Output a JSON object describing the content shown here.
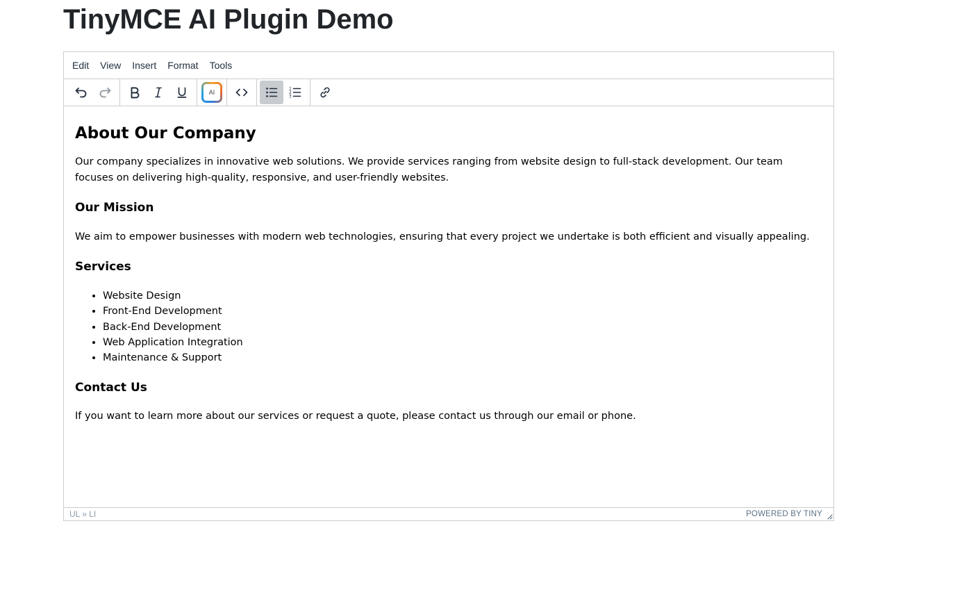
{
  "page": {
    "title": "TinyMCE AI Plugin Demo"
  },
  "menubar": {
    "items": [
      "Edit",
      "View",
      "Insert",
      "Format",
      "Tools"
    ]
  },
  "toolbar": {
    "undo_icon": "undo-icon",
    "redo_icon": "redo-icon",
    "bold_icon": "bold-icon",
    "italic_icon": "italic-icon",
    "underline_icon": "underline-icon",
    "ai_label": "AI",
    "code_icon": "code-icon",
    "bullist_icon": "bullet-list-icon",
    "numlist_icon": "numbered-list-icon",
    "link_icon": "link-icon",
    "active_button": "bullet-list"
  },
  "content": {
    "heading": "About Our Company",
    "intro": "Our company specializes in innovative web solutions. We provide services ranging from website design to full-stack development. Our team focuses on delivering high-quality, responsive, and user-friendly websites.",
    "mission_heading": "Our Mission",
    "mission_text": "We aim to empower businesses with modern web technologies, ensuring that every project we undertake is both efficient and visually appealing.",
    "services_heading": "Services",
    "services": [
      "Website Design",
      "Front-End Development",
      "Back-End Development",
      "Web Application Integration",
      "Maintenance & Support"
    ],
    "contact_heading": "Contact Us",
    "contact_text": "If you want to learn more about our services or request a quote, please contact us through our email or phone."
  },
  "statusbar": {
    "path": "UL » LI",
    "branding": "POWERED BY TINY"
  },
  "colors": {
    "border": "#cccccc",
    "active_button_bg": "#c8cbcf",
    "toolbar_icon": "#222f3e",
    "branding": "#5b7287"
  }
}
